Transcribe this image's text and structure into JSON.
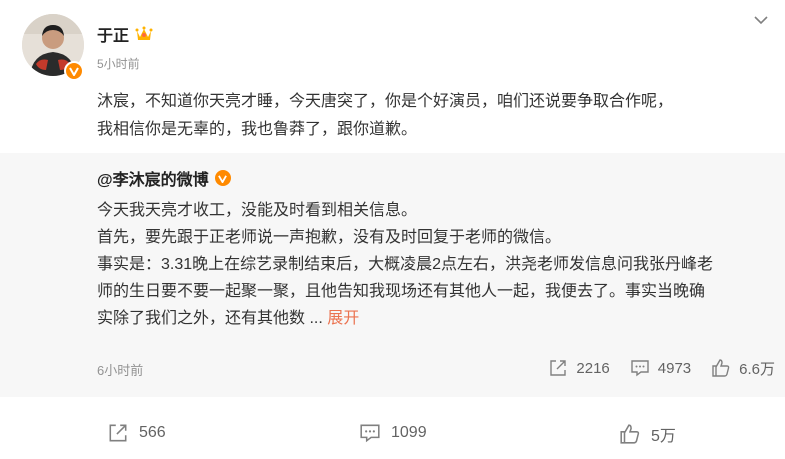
{
  "post": {
    "author": "于正",
    "time": "5小时前",
    "text_line1": "沐宸，不知道你天亮才睡，今天唐突了，你是个好演员，咱们还说要争取合作呢，",
    "text_line2": "我相信你是无辜的，我也鲁莽了，跟你道歉。"
  },
  "repost": {
    "author": "@李沐宸的微博",
    "lines": [
      "今天我天亮才收工，没能及时看到相关信息。",
      "首先，要先跟于正老师说一声抱歉，没有及时回复于老师的微信。",
      "事实是：3.31晚上在综艺录制结束后，大概凌晨2点左右，洪尧老师发信息问我张丹峰老",
      "师的生日要不要一起聚一聚，且他告知我现场还有其他人一起，我便去了。事实当晚确",
      "实除了我们之外，还有其他数"
    ],
    "ellipsis": "...",
    "expand_label": "展开",
    "time": "6小时前",
    "shares": "2216",
    "comments": "4973",
    "likes": "6.6万"
  },
  "actions": {
    "shares": "566",
    "comments": "1099",
    "likes": "5万"
  },
  "icons": {
    "more": "chevron-down-icon",
    "verified": "verified-badge-icon",
    "crown": "crown-icon",
    "share": "share-icon",
    "comment": "comment-icon",
    "like": "thumbs-up-icon"
  },
  "colors": {
    "accent": "#eb7350",
    "verified": "#ff8a00",
    "repost_bg": "#f7f7f7",
    "meta": "#939393"
  }
}
